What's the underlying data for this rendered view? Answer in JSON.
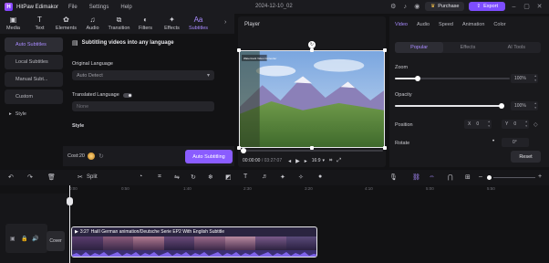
{
  "titlebar": {
    "app_name": "HitPaw Edimakor",
    "menu": [
      "File",
      "Settings",
      "Help"
    ],
    "doc_title": "2024-12-10_02",
    "purchase_label": "Purchase",
    "export_label": "Export"
  },
  "tools": [
    {
      "label": "Media",
      "icon": "media-icon"
    },
    {
      "label": "Text",
      "icon": "text-icon"
    },
    {
      "label": "Elements",
      "icon": "elements-icon"
    },
    {
      "label": "Audio",
      "icon": "audio-icon"
    },
    {
      "label": "Transition",
      "icon": "transition-icon"
    },
    {
      "label": "Filters",
      "icon": "filters-icon"
    },
    {
      "label": "Effects",
      "icon": "effects-icon"
    },
    {
      "label": "Subtitles",
      "icon": "subtitles-icon",
      "active": true
    }
  ],
  "sidenav": {
    "items": [
      "Auto Subtitles",
      "Local Subtitles",
      "Manual Subt...",
      "Custom"
    ],
    "style_label": "Style"
  },
  "subtitles": {
    "header": "Subtitling videos into any language",
    "original_language_label": "Original Language",
    "original_language_value": "Auto Detect",
    "translated_language_label": "Translated Language",
    "translated_language_value": "None",
    "style_label": "Style",
    "cost_label": "Cost:20",
    "auto_button": "Auto Subtitling"
  },
  "player": {
    "title": "Player",
    "overlay_text": "Watermark Video Converter",
    "current_time": "00:00:00",
    "total_time": "03:27:07",
    "aspect_ratio": "16:9"
  },
  "right_panel": {
    "tabs": [
      "Video",
      "Audio",
      "Speed",
      "Animation",
      "Color"
    ],
    "segments": [
      "Popular",
      "Effects",
      "AI Tools"
    ],
    "zoom_label": "Zoom",
    "zoom_value": "100%",
    "opacity_label": "Opacity",
    "opacity_value": "100%",
    "position_label": "Position",
    "pos_x_label": "X",
    "pos_x_value": "0",
    "pos_y_label": "Y",
    "pos_y_value": "0",
    "rotate_label": "Rotate",
    "rotate_value": "0°",
    "reset_label": "Reset"
  },
  "timeline": {
    "split_label": "Split",
    "ruler_ticks": [
      "0:00",
      "0:50",
      "1:40",
      "2:30",
      "3:20",
      "4:10",
      "5:00",
      "5:50"
    ],
    "cover_label": "Cover",
    "clip_duration": "3:27",
    "clip_title": "HaiII German animation/Deutsche Serie EP2 With English Subtitle"
  },
  "colors": {
    "accent": "#8a5cff",
    "accent_text": "#a98bff",
    "background": "#121214",
    "panel": "#19191c"
  }
}
